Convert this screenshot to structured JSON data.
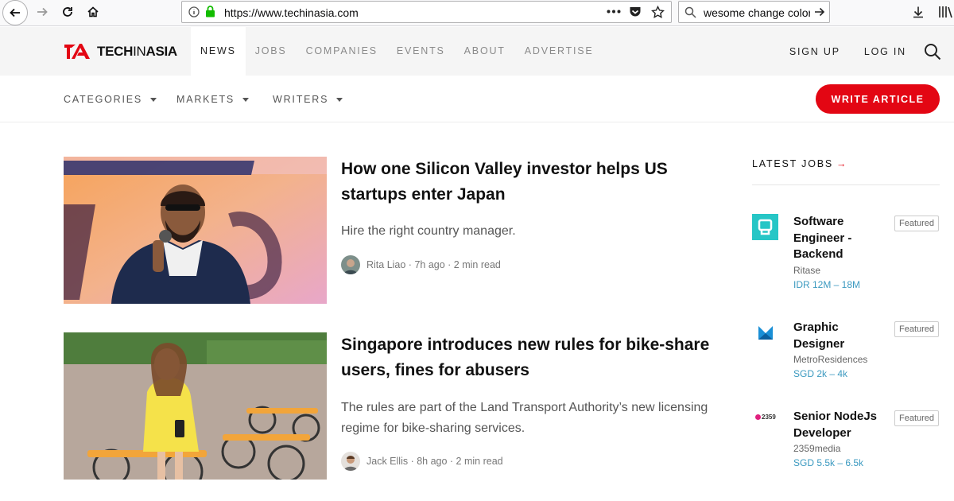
{
  "browser": {
    "url_host": "https://www.techinasia.com",
    "search_value": "wesome change color"
  },
  "site": {
    "logo_prefix": "TECH",
    "logo_mid": "IN",
    "logo_suffix": "ASIA",
    "brand_color": "#e30613",
    "nav": [
      {
        "label": "NEWS",
        "active": true
      },
      {
        "label": "JOBS"
      },
      {
        "label": "COMPANIES"
      },
      {
        "label": "EVENTS"
      },
      {
        "label": "ABOUT"
      },
      {
        "label": "ADVERTISE"
      }
    ],
    "sign_up": "SIGN UP",
    "log_in": "LOG IN"
  },
  "subnav": {
    "categories": "CATEGORIES",
    "markets": "MARKETS",
    "writers": "WRITERS",
    "write_article": "WRITE ARTICLE"
  },
  "articles": [
    {
      "title": "How one Silicon Valley investor helps US startups enter Japan",
      "subtitle": "Hire the right country manager.",
      "meta": "Rita Liao · 7h ago · 2 min read"
    },
    {
      "title": "Singapore introduces new rules for bike-share users, fines for abusers",
      "subtitle": "The rules are part of the Land Transport Authority’s new licensing regime for bike-sharing services.",
      "meta": "Jack Ellis · 8h ago · 2 min read"
    }
  ],
  "sidebar": {
    "latest_jobs": "LATEST JOBS",
    "arrow": "→",
    "jobs": [
      {
        "title": "Software Engineer - Backend",
        "company": "Ritase",
        "salary": "IDR 12M – 18M",
        "badge": "Featured"
      },
      {
        "title": "Graphic Designer",
        "company": "MetroResidences",
        "salary": "SGD 2k – 4k",
        "badge": "Featured"
      },
      {
        "title": "Senior NodeJs Developer",
        "company": "2359media",
        "salary": "SGD 5.5k – 6.5k",
        "badge": "Featured",
        "logo_text": "2359"
      }
    ]
  }
}
